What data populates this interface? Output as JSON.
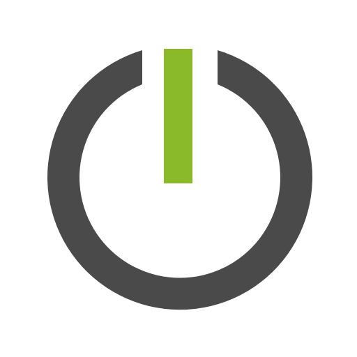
{
  "icon": {
    "name": "power-icon",
    "ring_color": "#4a4a4a",
    "bar_color": "#8aba2a",
    "background": "#ffffff"
  }
}
